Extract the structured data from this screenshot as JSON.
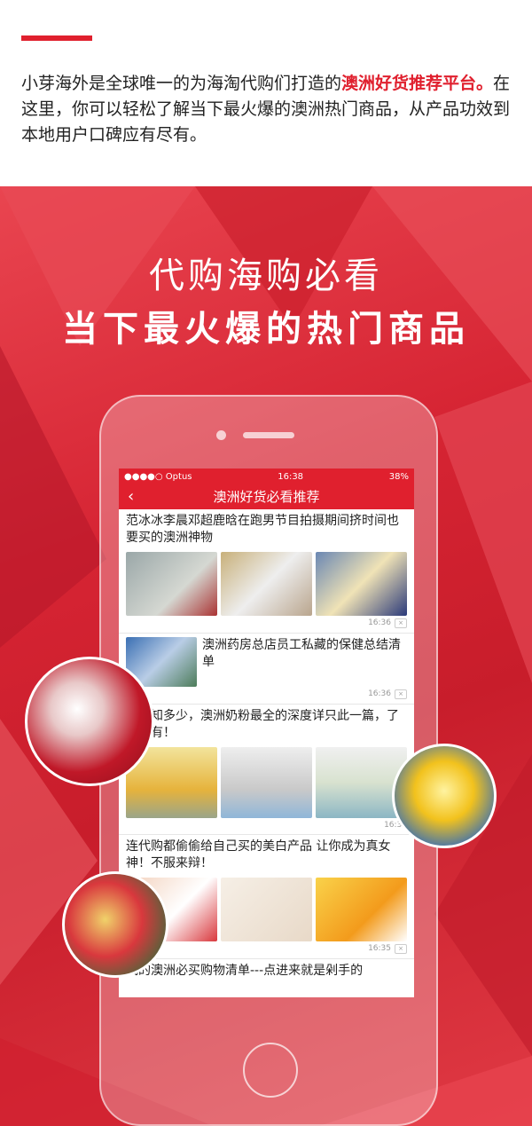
{
  "intro": {
    "text_before": "小芽海外是全球唯一的为海淘代购们打造的",
    "highlight": "澳洲好货推荐平台。",
    "text_after": "在这里，你可以轻松了解当下最火爆的澳洲热门商品，从产品功效到本地用户口碑应有尽有。"
  },
  "headline": {
    "line1": "代购海购必看",
    "line2": "当下最火爆的热门商品"
  },
  "status_bar": {
    "carrier": "●●●●○ Optus",
    "time": "16:38",
    "battery": "38%"
  },
  "nav": {
    "back_glyph": "‹",
    "title": "澳洲好货必看推荐"
  },
  "articles": [
    {
      "title": "范冰冰李晨邓超鹿晗在跑男节目拍摄期间挤时间也要买的澳洲神物",
      "time": "16:36"
    },
    {
      "title": "澳洲药房总店员工私藏的保健总结清单",
      "time": "16:36"
    },
    {
      "title": "奶粉知多少，澳洲奶粉最全的深度详只此一篇，了解所有！",
      "time": "16:36"
    },
    {
      "title": "连代购都偷偷给自己买的美白产品 让你成为真女神！不服来辩！",
      "time": "16:35"
    },
    {
      "title": "我的澳洲必买购物清单---点进来就是剁手的",
      "time": ""
    }
  ],
  "dismiss_glyph": "×",
  "colors": {
    "accent": "#e0202e",
    "banner": "#d62433"
  }
}
